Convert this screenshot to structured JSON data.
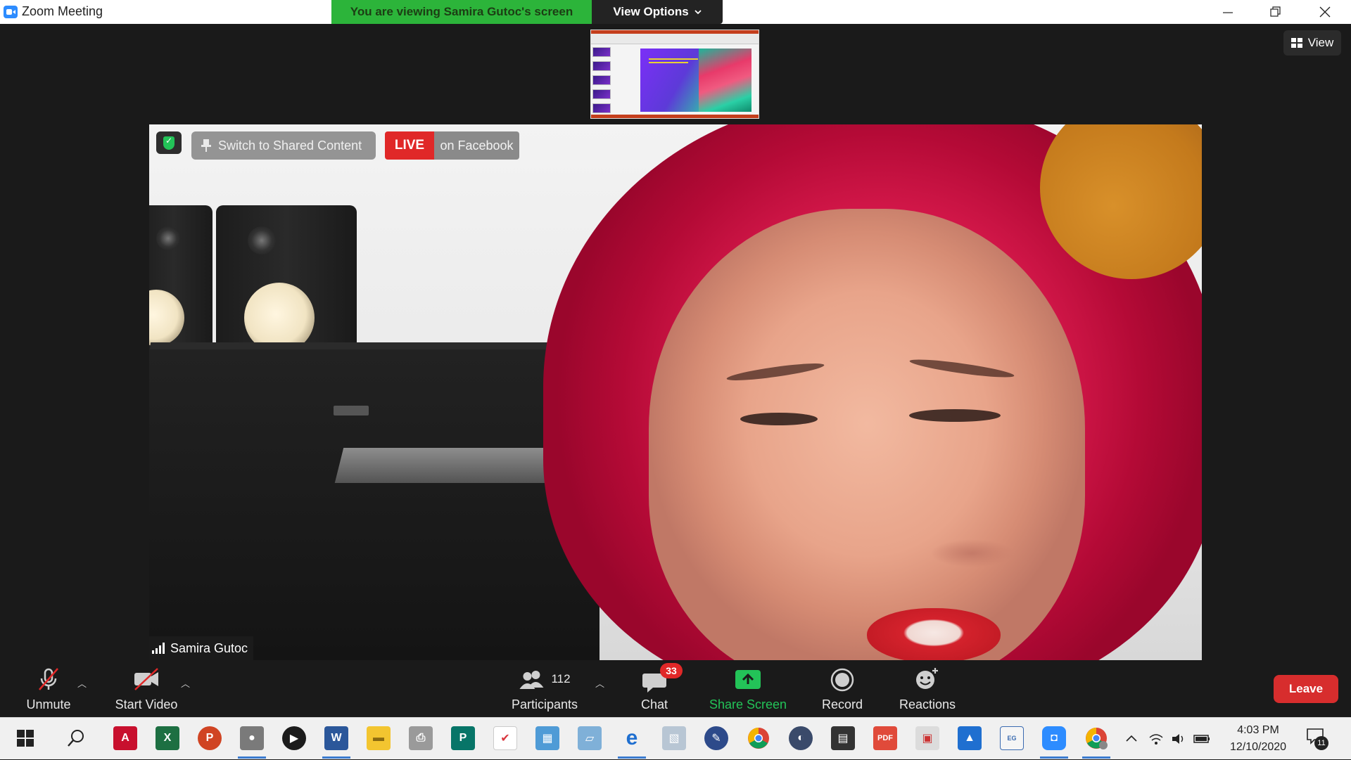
{
  "window": {
    "title": "Zoom Meeting",
    "minimize_icon": "minimize-icon",
    "restore_icon": "restore-icon",
    "close_icon": "close-icon"
  },
  "banner": {
    "viewing_text": "You are viewing Samira Gutoc's screen",
    "view_options_label": "View Options",
    "banner_color": "#2cb43a"
  },
  "view_button": {
    "label": "View"
  },
  "video": {
    "switch_label": "Switch to Shared Content",
    "live_label": "LIVE",
    "live_target": "on Facebook",
    "participant_name": "Samira Gutoc"
  },
  "toolbar": {
    "unmute_label": "Unmute",
    "start_video_label": "Start Video",
    "participants_label": "Participants",
    "participants_count": "112",
    "chat_label": "Chat",
    "chat_badge": "33",
    "share_label": "Share Screen",
    "record_label": "Record",
    "reactions_label": "Reactions",
    "leave_label": "Leave",
    "share_color": "#23c358",
    "leave_color": "#d72d2d"
  },
  "taskbar": {
    "apps": [
      "windows-start",
      "search",
      "acrobat",
      "excel",
      "powerpoint",
      "voice-recorder",
      "media-player",
      "word",
      "file-explorer",
      "printer",
      "publisher",
      "todo",
      "control-panel",
      "notepad",
      "edge",
      "image-viewer",
      "pen-tool",
      "chrome",
      "mirror-app",
      "store",
      "pdf-tool",
      "photo-editor",
      "photos",
      "english-grammar",
      "zoom",
      "chrome-profile"
    ],
    "time": "4:03 PM",
    "date": "12/10/2020",
    "notification_count": "11"
  }
}
